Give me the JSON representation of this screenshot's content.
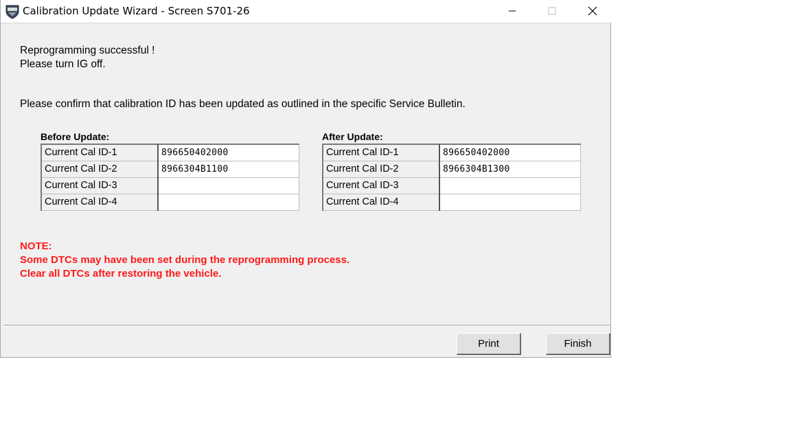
{
  "window": {
    "title": "Calibration Update Wizard - Screen S701-26",
    "app_icon": "shield-logo-icon"
  },
  "messages": {
    "line1": "Reprogramming successful !",
    "line2": "Please turn IG off.",
    "confirm": "Please confirm that calibration ID has been updated as outlined in the specific Service Bulletin."
  },
  "before": {
    "heading": "Before Update:",
    "rows": [
      {
        "label": "Current Cal ID-1",
        "value": "896650402000"
      },
      {
        "label": "Current Cal ID-2",
        "value": "8966304B1100"
      },
      {
        "label": "Current Cal ID-3",
        "value": ""
      },
      {
        "label": "Current Cal ID-4",
        "value": ""
      }
    ]
  },
  "after": {
    "heading": "After Update:",
    "rows": [
      {
        "label": "Current Cal ID-1",
        "value": "896650402000"
      },
      {
        "label": "Current Cal ID-2",
        "value": "8966304B1300"
      },
      {
        "label": "Current Cal ID-3",
        "value": ""
      },
      {
        "label": "Current Cal ID-4",
        "value": ""
      }
    ]
  },
  "note": {
    "title": "NOTE:",
    "line1": "Some DTCs may have been set during the reprogramming process.",
    "line2": "Clear all DTCs after restoring the vehicle.",
    "color": "#ff1a1a"
  },
  "buttons": {
    "print": "Print",
    "finish": "Finish"
  }
}
